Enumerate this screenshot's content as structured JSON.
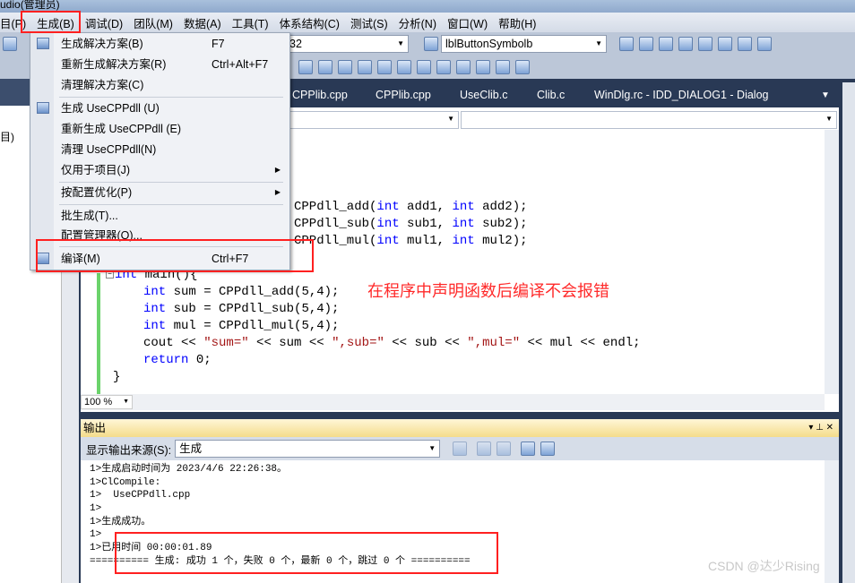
{
  "window": {
    "title": "udio(管理员)"
  },
  "menubar": [
    "目(P)",
    "生成(B)",
    "调试(D)",
    "团队(M)",
    "数据(A)",
    "工具(T)",
    "体系结构(C)",
    "测试(S)",
    "分析(N)",
    "窗口(W)",
    "帮助(H)"
  ],
  "toolbar": {
    "config_combo": "32",
    "symbol_combo": "lblButtonSymbolb"
  },
  "tabs": [
    "CPPlib.cpp",
    "CPPlib.cpp",
    "UseClib.c",
    "Clib.c",
    "WinDlg.rc - IDD_DIALOG1 - Dialog"
  ],
  "left_panel": {
    "text": "目)"
  },
  "build_menu": [
    {
      "label": "生成解决方案(B)",
      "shortcut": "F7",
      "icon": "build-solution-icon"
    },
    {
      "label": "重新生成解决方案(R)",
      "shortcut": "Ctrl+Alt+F7"
    },
    {
      "label": "清理解决方案(C)"
    },
    {
      "label": "生成 UseCPPdll (U)",
      "icon": "build-project-icon"
    },
    {
      "label": "重新生成 UseCPPdll (E)"
    },
    {
      "label": "清理 UseCPPdll(N)"
    },
    {
      "label": "仅用于项目(J)",
      "submenu": true
    },
    {
      "label": "按配置优化(P)",
      "submenu": true
    },
    {
      "label": "批生成(T)..."
    },
    {
      "label": "配置管理器(O)..."
    },
    {
      "label": "编译(M)",
      "shortcut": "Ctrl+F7",
      "icon": "compile-icon"
    }
  ],
  "code": {
    "decl": [
      {
        "fn": "CPPdll_add(",
        "a": "add1, ",
        "b": "add2);"
      },
      {
        "fn": "CPPdll_sub(",
        "a": "sub1, ",
        "b": "sub2);"
      },
      {
        "fn": "CPPdll_mul(",
        "a": "mul1, ",
        "b": "mul2);"
      }
    ],
    "kw_int": "int",
    "main": " main(){",
    "body": [
      {
        "var": " sum = CPPdll_add(5,4);"
      },
      {
        "var": " sub = CPPdll_sub(5,4);"
      },
      {
        "var": " mul = CPPdll_mul(5,4);"
      }
    ],
    "cout": {
      "a": "cout << ",
      "s1": "\"sum=\"",
      "b": " << sum << ",
      "s2": "\",sub=\"",
      "c": " << sub << ",
      "s3": "\",mul=\"",
      "d": " << mul << endl;"
    },
    "ret_kw": "return",
    "ret": " 0;",
    "close": "}"
  },
  "editor": {
    "zoom": "100 %"
  },
  "output": {
    "title": "输出",
    "source_label": "显示输出来源(S):",
    "source_value": "生成",
    "lines": [
      "1>生成启动时间为 2023/4/6 22:26:38。",
      "1>ClCompile:",
      "1>  UseCPPdll.cpp",
      "1>",
      "1>生成成功。",
      "1>",
      "1>已用时间 00:00:01.89",
      "========== 生成: 成功 1 个，失败 0 个，最新 0 个，跳过 0 个 =========="
    ]
  },
  "annotation": "在程序中声明函数后编译不会报错",
  "watermark": "CSDN @达少Rising",
  "colors": {
    "highlight": "#ff2020",
    "keyword": "#0000ff",
    "string": "#a31515",
    "tabstrip": "#293955"
  }
}
